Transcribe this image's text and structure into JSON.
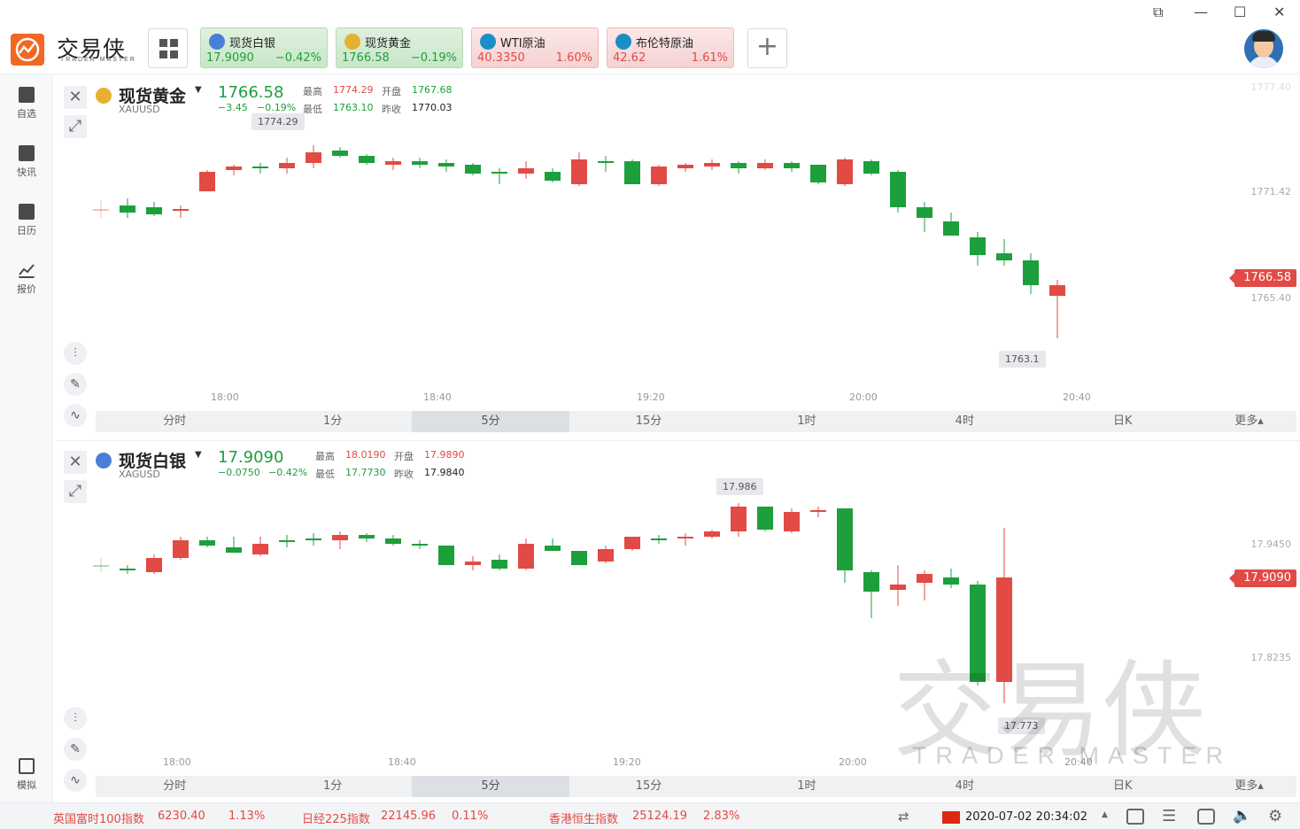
{
  "app": {
    "logo_text": "交易侠",
    "logo_sub": "TRADER MASTER",
    "window_controls": [
      "⧉",
      "—",
      "☐",
      "✕"
    ]
  },
  "tickers": [
    {
      "name": "现货白银",
      "price": "17.9090",
      "change": "−0.42%",
      "direction": "down",
      "icon_color": "#4a7fd8"
    },
    {
      "name": "现货黄金",
      "price": "1766.58",
      "change": "−0.19%",
      "direction": "down",
      "icon_color": "#e6b030"
    },
    {
      "name": "WTI原油",
      "price": "40.3350",
      "change": "1.60%",
      "direction": "up",
      "icon_color": "#1a8fc7"
    },
    {
      "name": "布伦特原油",
      "price": "42.62",
      "change": "1.61%",
      "direction": "up",
      "icon_color": "#1a8fc7"
    }
  ],
  "sidebar": {
    "items": [
      {
        "label": "自选",
        "icon": "bookmark-plus-icon"
      },
      {
        "label": "快讯",
        "icon": "news-icon"
      },
      {
        "label": "日历",
        "icon": "calendar-icon"
      },
      {
        "label": "报价",
        "icon": "quote-chart-icon"
      },
      {
        "label": "模拟",
        "icon": "wallet-icon"
      }
    ]
  },
  "panels": [
    {
      "name": "现货黄金",
      "code": "XAUUSD",
      "price": "1766.58",
      "change": "−3.45",
      "change_pct": "−0.19%",
      "high_label": "最高",
      "high": "1774.29",
      "open_label": "开盘",
      "open": "1767.68",
      "low_label": "最低",
      "low": "1763.10",
      "prev_label": "昨收",
      "prev": "1770.03",
      "y_labels": [
        "1777.40",
        "1771.42",
        "1765.40"
      ],
      "price_tag": "1766.58",
      "callout_high": "1774.29",
      "callout_low": "1763.1",
      "x_labels": [
        "18:00",
        "18:40",
        "19:20",
        "20:00",
        "20:40"
      ],
      "periods": [
        "分时",
        "1分",
        "5分",
        "15分",
        "1时",
        "4时",
        "日K",
        "更多▴"
      ],
      "active_period": "5分"
    },
    {
      "name": "现货白银",
      "code": "XAGUSD",
      "price": "17.9090",
      "change": "−0.0750",
      "change_pct": "−0.42%",
      "high_label": "最高",
      "high": "18.0190",
      "open_label": "开盘",
      "open": "17.9890",
      "low_label": "最低",
      "low": "17.7730",
      "prev_label": "昨收",
      "prev": "17.9840",
      "y_labels": [
        "17.9450",
        "17.8235"
      ],
      "price_tag": "17.9090",
      "callout_high": "17.986",
      "callout_low": "17.773",
      "x_labels": [
        "18:00",
        "18:40",
        "19:20",
        "20:00",
        "20:40"
      ],
      "periods": [
        "分时",
        "1分",
        "5分",
        "15分",
        "1时",
        "4时",
        "日K",
        "更多▴"
      ],
      "active_period": "5分"
    }
  ],
  "watermark": {
    "text": "交易侠",
    "sub": "TRADER MASTER"
  },
  "bottom": {
    "indices": [
      {
        "name": "英国富时100指数",
        "value": "6230.40",
        "change": "1.13%"
      },
      {
        "name": "日经225指数",
        "value": "22145.96",
        "change": "0.11%"
      },
      {
        "name": "香港恒生指数",
        "value": "25124.19",
        "change": "2.83%"
      }
    ],
    "datetime": "2020-07-02 20:34:02"
  },
  "colors": {
    "up": "#e24a45",
    "down": "#1d9f3c",
    "accent": "#f26722"
  }
}
